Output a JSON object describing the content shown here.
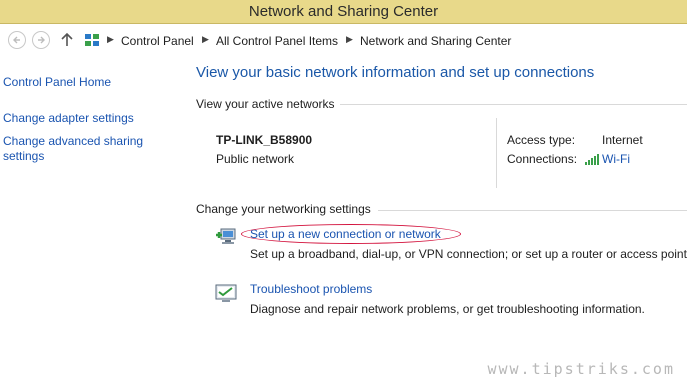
{
  "window": {
    "title": "Network and Sharing Center"
  },
  "address_bar": {
    "breadcrumbs": [
      "Control Panel",
      "All Control Panel Items",
      "Network and Sharing Center"
    ]
  },
  "sidebar": {
    "items": [
      {
        "label": "Control Panel Home"
      },
      {
        "label": "Change adapter settings"
      },
      {
        "label": "Change advanced sharing"
      },
      {
        "label": "settings"
      }
    ]
  },
  "main": {
    "title": "View your basic network information and set up connections",
    "active_networks_label": "View your active networks",
    "network": {
      "name": "TP-LINK_B58900",
      "category": "Public network",
      "access_type_label": "Access type:",
      "access_type_value": "Internet",
      "connections_label": "Connections:",
      "connections_value": "Wi-Fi"
    },
    "settings_label": "Change your networking settings",
    "tasks": [
      {
        "icon": "new-connection-icon",
        "link": "Set up a new connection or network",
        "description": "Set up a broadband, dial-up, or VPN connection; or set up a router or access point."
      },
      {
        "icon": "troubleshoot-icon",
        "link": "Troubleshoot problems",
        "description": "Diagnose and repair network problems, or get troubleshooting information."
      }
    ]
  },
  "watermark": "www.tipstriks.com",
  "colors": {
    "titlebar": "#e8d98a",
    "link": "#1a54b0",
    "title": "#1b58a8",
    "highlight": "#d3143e"
  }
}
